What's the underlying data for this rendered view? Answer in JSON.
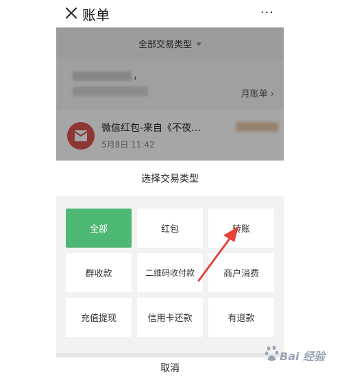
{
  "header": {
    "title": "账单",
    "more_label": "···"
  },
  "filter": {
    "label": "全部交易类型"
  },
  "summary": {
    "punct": "，",
    "monthly_label": "月账单 ›"
  },
  "transaction": {
    "title": "微信红包-来自《不夜…",
    "time": "5月8日 11:42"
  },
  "sheet": {
    "title": "选择交易类型",
    "options": [
      {
        "label": "全部",
        "selected": true
      },
      {
        "label": "红包",
        "selected": false
      },
      {
        "label": "转账",
        "selected": false
      },
      {
        "label": "群收款",
        "selected": false
      },
      {
        "label": "二维码收付款",
        "selected": false
      },
      {
        "label": "商户消费",
        "selected": false
      },
      {
        "label": "充值提现",
        "selected": false
      },
      {
        "label": "信用卡还款",
        "selected": false
      },
      {
        "label": "有退款",
        "selected": false
      }
    ],
    "cancel_label": "取消"
  },
  "watermark": {
    "text": "Bai 经验"
  },
  "colors": {
    "accent": "#4cb874",
    "annotation_arrow": "#e8413a",
    "red_packet": "#d9534f"
  }
}
